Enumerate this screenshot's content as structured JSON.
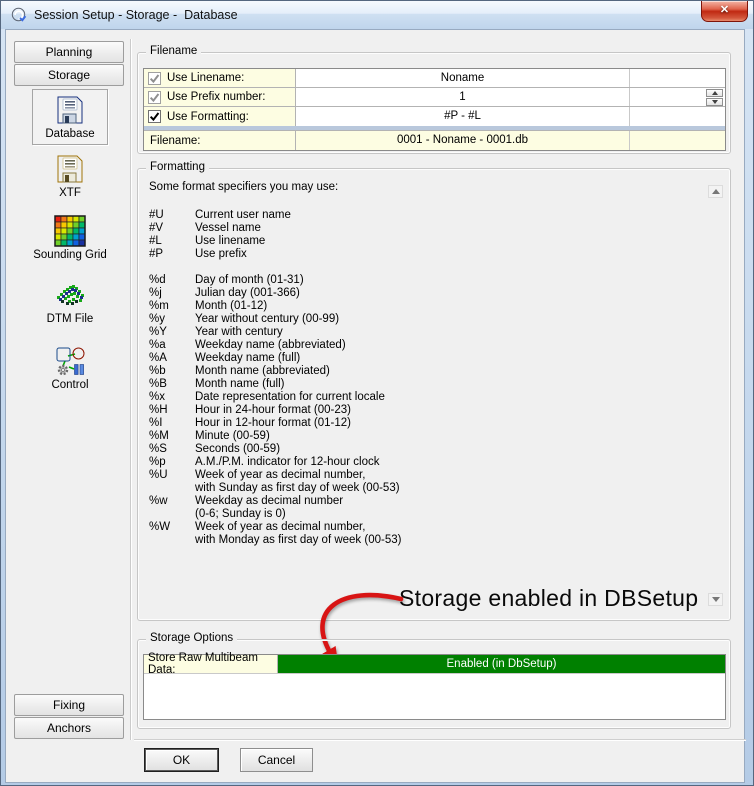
{
  "window": {
    "title": "Session Setup - Storage -  Database",
    "close_glyph": "✕"
  },
  "sidebar": {
    "top_buttons": [
      "Planning",
      "Storage"
    ],
    "items": [
      {
        "label": "Database",
        "icon": "database-floppy-blue-icon",
        "selected": true
      },
      {
        "label": "XTF",
        "icon": "xtf-floppy-yellow-icon",
        "selected": false
      },
      {
        "label": "Sounding Grid",
        "icon": "sounding-grid-icon",
        "selected": false
      },
      {
        "label": "DTM File",
        "icon": "dtm-file-icon",
        "selected": false
      },
      {
        "label": "Control",
        "icon": "control-icon",
        "selected": false
      }
    ],
    "bottom_buttons": [
      "Fixing",
      "Anchors"
    ]
  },
  "filename_group": {
    "title": "Filename",
    "rows": [
      {
        "label": "Use Linename:",
        "checked": true,
        "enabled": false,
        "value": "Noname",
        "spinner": false
      },
      {
        "label": "Use Prefix number:",
        "checked": true,
        "enabled": false,
        "value": "1",
        "spinner": true
      },
      {
        "label": "Use Formatting:",
        "checked": true,
        "enabled": true,
        "value": "#P - #L",
        "spinner": false
      }
    ],
    "result_row": {
      "label": "Filename:",
      "value": "0001 - Noname - 0001.db"
    }
  },
  "formatting_group": {
    "title": "Formatting",
    "intro": "Some format specifiers you may use:",
    "specifiers": [
      {
        "code": "#U",
        "lines": [
          "Current user name"
        ]
      },
      {
        "code": "#V",
        "lines": [
          "Vessel name"
        ]
      },
      {
        "code": "#L",
        "lines": [
          "Use linename"
        ]
      },
      {
        "code": "#P",
        "lines": [
          "Use prefix"
        ]
      },
      {
        "code": "%d",
        "gap": true,
        "lines": [
          "Day of month (01-31)"
        ]
      },
      {
        "code": "%j",
        "lines": [
          "Julian day (001-366)"
        ]
      },
      {
        "code": "%m",
        "lines": [
          "Month (01-12)"
        ]
      },
      {
        "code": "%y",
        "lines": [
          "Year without century (00-99)"
        ]
      },
      {
        "code": "%Y",
        "lines": [
          "Year with century"
        ]
      },
      {
        "code": "%a",
        "lines": [
          "Weekday name (abbreviated)"
        ]
      },
      {
        "code": "%A",
        "lines": [
          "Weekday name (full)"
        ]
      },
      {
        "code": "%b",
        "lines": [
          "Month name (abbreviated)"
        ]
      },
      {
        "code": "%B",
        "lines": [
          "Month name (full)"
        ]
      },
      {
        "code": "%x",
        "lines": [
          "Date representation for current locale"
        ]
      },
      {
        "code": "%H",
        "lines": [
          "Hour in 24-hour format (00-23)"
        ]
      },
      {
        "code": "%I",
        "lines": [
          "Hour in 12-hour format (01-12)"
        ]
      },
      {
        "code": "%M",
        "lines": [
          "Minute (00-59)"
        ]
      },
      {
        "code": "%S",
        "lines": [
          "Seconds (00-59)"
        ]
      },
      {
        "code": "%p",
        "lines": [
          "A.M./P.M. indicator for 12-hour clock"
        ]
      },
      {
        "code": "%U",
        "lines": [
          "Week of year as decimal number,",
          "with Sunday as first day of week (00-53)"
        ]
      },
      {
        "code": "%w",
        "lines": [
          "Weekday as decimal number",
          "(0-6; Sunday is 0)"
        ]
      },
      {
        "code": "%W",
        "lines": [
          "Week of year as decimal number,",
          "with Monday as first day of week (00-53)"
        ]
      }
    ]
  },
  "annotation": {
    "text": "Storage enabled in DBSetup"
  },
  "storage_group": {
    "title": "Storage Options",
    "row": {
      "label": "Store Raw Multibeam Data:",
      "value": "Enabled (in DbSetup)"
    }
  },
  "footer": {
    "ok_label": "OK",
    "cancel_label": "Cancel"
  },
  "colors": {
    "cell_yellow": "#fdfde2",
    "enabled_green": "#008000",
    "arrow_red": "#d81414",
    "close_red": "#c02912",
    "separator_blue": "#b9c8dc"
  }
}
